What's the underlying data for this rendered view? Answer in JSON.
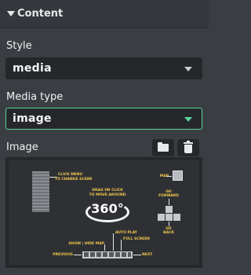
{
  "section": {
    "title": "Content"
  },
  "fields": {
    "style": {
      "label": "Style",
      "value": "media"
    },
    "media_type": {
      "label": "Media type",
      "value": "image"
    },
    "image": {
      "label": "Image"
    }
  },
  "preview_labels": {
    "click_menu": "CLICK MENU",
    "to_change_scene": "TO CHANGE SCENE",
    "map": "MAP",
    "drag": "DRAG OR CLICK",
    "to_move": "TO MOVE AROUND",
    "degrees": "360°",
    "go": "GO",
    "forward": "FORWARD",
    "go2": "GO",
    "back": "BACK",
    "auto_play": "AUTO PLAY",
    "full_screen": "FULL SCREEN",
    "show_hide_map": "SHOW | HIDE MAP",
    "previous": "PREVIOUS",
    "next": "NEXT"
  },
  "colors": {
    "accent": "#5fd49a",
    "panel": "#3a3d42",
    "input_bg": "#25272b",
    "annotation": "#f2c94c"
  },
  "icons": {
    "section_toggle": "caret-down-icon",
    "select_arrow": "chevron-down-icon",
    "upload": "folder-icon",
    "delete": "trash-icon"
  }
}
